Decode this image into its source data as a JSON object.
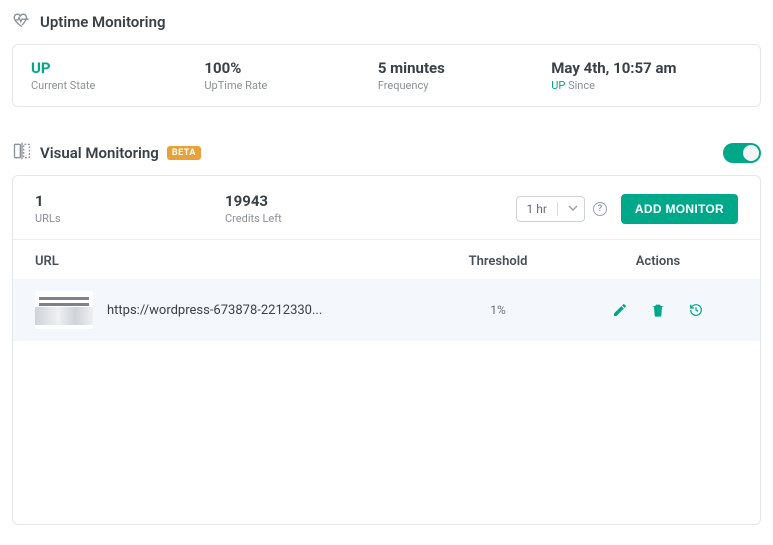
{
  "uptime": {
    "section_title": "Uptime Monitoring",
    "state_value": "UP",
    "state_label": "Current State",
    "rate_value": "100%",
    "rate_label": "UpTime Rate",
    "freq_value": "5 minutes",
    "freq_label": "Frequency",
    "since_value": "May 4th, 10:57 am",
    "since_prefix": "UP",
    "since_label": "Since"
  },
  "visual": {
    "section_title": "Visual Monitoring",
    "beta": "BETA",
    "urls_count": "1",
    "urls_label": "URLs",
    "credits_value": "19943",
    "credits_label": "Credits Left",
    "freq_selected": "1 hr",
    "add_button": "ADD MONITOR",
    "col_url": "URL",
    "col_threshold": "Threshold",
    "col_actions": "Actions",
    "rows": [
      {
        "url": "https://wordpress-673878-2212330...",
        "threshold": "1%"
      }
    ]
  }
}
